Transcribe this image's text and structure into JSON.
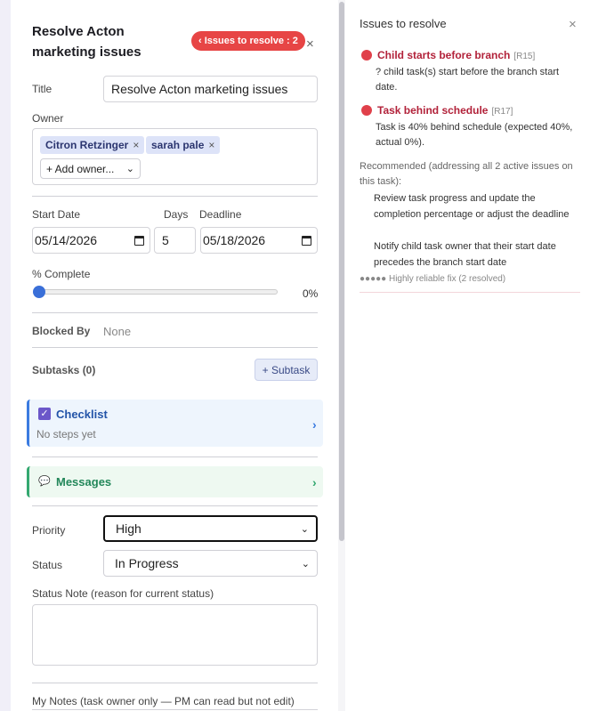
{
  "task": {
    "title": "Resolve Acton marketing issues",
    "issues_badge": "‹ Issues to resolve : 2",
    "close_glyph": "×",
    "title_label": "Title",
    "title_value": "Resolve Acton marketing issues",
    "owner_label": "Owner",
    "owners": [
      {
        "name": "Citron Retzinger",
        "remove": "×"
      },
      {
        "name": "sarah pale",
        "remove": "×"
      }
    ],
    "add_owner": "+ Add owner...",
    "start_date_label": "Start Date",
    "start_date": "05/14/2026",
    "days_label": "Days",
    "days": "5",
    "deadline_label": "Deadline",
    "deadline": "05/18/2026",
    "complete_label": "% Complete",
    "complete_value": "0%",
    "complete_fraction": 0,
    "blocked_label": "Blocked By",
    "blocked_value": "None",
    "subtasks_label": "Subtasks (0)",
    "subtask_button": "+ Subtask",
    "checklist_title": "Checklist",
    "checklist_sub": "No steps yet",
    "checklist_arrow": "›",
    "messages_icon": "💬",
    "messages_title": "Messages",
    "messages_arrow": "›",
    "priority_label": "Priority",
    "priority_value": "High",
    "status_label": "Status",
    "status_value": "In Progress",
    "status_note_label": "Status Note (reason for current status)",
    "my_notes_label": "My Notes (task owner only — PM can read but not edit)",
    "select_chevron": "⌄"
  },
  "issues_panel": {
    "title": "Issues to resolve",
    "close_glyph": "×",
    "issues": [
      {
        "title": "Child starts before branch",
        "code": "[R15]",
        "desc": "? child task(s) start before the branch start date."
      },
      {
        "title": "Task behind schedule",
        "code": "[R17]",
        "desc": "Task is 40% behind schedule (expected 40%, actual 0%)."
      }
    ],
    "recommended": "Recommended (addressing all 2 active issues on this task):",
    "recommendations": [
      "Review task progress and update the completion percentage or adjust the deadline",
      "Notify child task owner that their start date precedes the branch start date"
    ],
    "reliability": "●●●●● Highly reliable fix (2 resolved)"
  },
  "colors": {
    "badge": "#e74545",
    "accent_blue": "#3b7be0",
    "accent_green": "#34a870",
    "issue_red": "#b2223a"
  }
}
